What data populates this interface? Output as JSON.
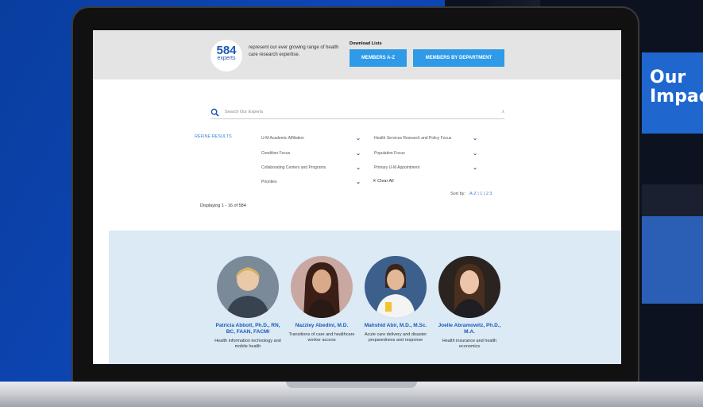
{
  "right_panel": {
    "title": "Our\nImpac"
  },
  "header": {
    "badge_number": "584",
    "badge_label": "experts",
    "tagline": "represent our ever growing range of health care research expertise.",
    "download_title": "Download Lists",
    "buttons": {
      "members_az": "MEMBERS A-Z",
      "members_by_dept": "MEMBERS BY DEPARTMENT"
    }
  },
  "search": {
    "placeholder": "Search Our Experts",
    "clear": "x"
  },
  "filters": {
    "refine_label": "REFINE RESULTS",
    "items": [
      {
        "label": "U-M Academic Affiliation"
      },
      {
        "label": "Health Services Research and Policy Focus"
      },
      {
        "label": "Condition Focus"
      },
      {
        "label": "Population Focus"
      },
      {
        "label": "Collaborating Centers and Programs"
      },
      {
        "label": "Primary U-M Appointment"
      },
      {
        "label": "Priorities"
      }
    ],
    "clear_all": "✕ Clear All"
  },
  "sort": {
    "label": "Sort by:",
    "options": "A-Z | 1 | 2 3"
  },
  "results": {
    "displaying": "Displaying 1 - 16 of 584"
  },
  "experts": [
    {
      "name": "Patricia Abbott, Ph.D., RN, BC, FAAN, FACMI",
      "focus": "Health information technology and mobile health"
    },
    {
      "name": "Nazzley Abedini, M.D.",
      "focus": "Transitions of care and healthcare worker access"
    },
    {
      "name": "Mahshid Abir, M.D., M.Sc.",
      "focus": "Acute care delivery and disaster preparedness and response"
    },
    {
      "name": "Joelle Abramowitz, Ph.D., M.A.",
      "focus": "Health insurance and health economics"
    }
  ],
  "colors": {
    "brand_blue": "#1a58b7",
    "button_blue": "#2e9ae8",
    "band": "#dbeaf5",
    "page_bg": "#0d47b8"
  }
}
